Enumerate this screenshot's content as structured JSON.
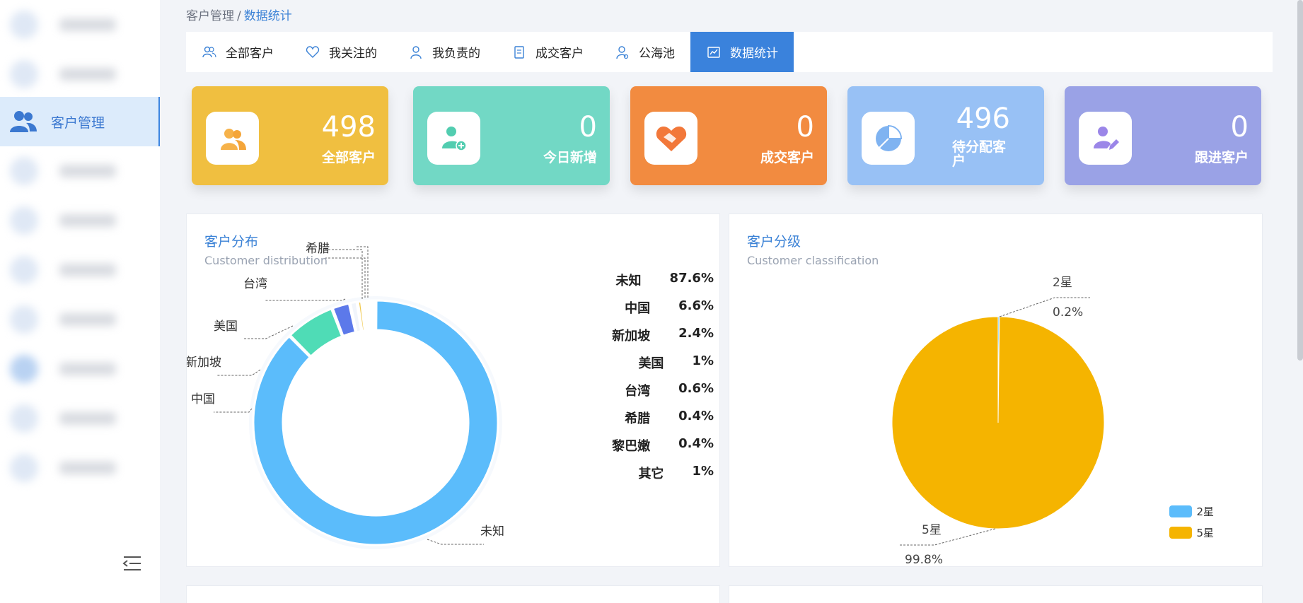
{
  "sidebar": {
    "active_label": "客户管理"
  },
  "breadcrumb": {
    "parent": "客户管理",
    "separator": "/",
    "current": "数据统计"
  },
  "tabs": [
    {
      "label": "全部客户",
      "icon": "users-icon"
    },
    {
      "label": "我关注的",
      "icon": "heart-icon"
    },
    {
      "label": "我负责的",
      "icon": "user-icon"
    },
    {
      "label": "成交客户",
      "icon": "document-icon"
    },
    {
      "label": "公海池",
      "icon": "user-settings-icon"
    },
    {
      "label": "数据统计",
      "icon": "chart-icon"
    }
  ],
  "cards": [
    {
      "value": "498",
      "label": "全部客户",
      "color": "#f0bf40"
    },
    {
      "value": "0",
      "label": "今日新增",
      "color": "#72d8c5"
    },
    {
      "value": "0",
      "label": "成交客户",
      "color": "#f28b40"
    },
    {
      "value": "496",
      "label": "待分配客户",
      "color": "#98c1f5"
    },
    {
      "value": "0",
      "label": "跟进客户",
      "color": "#9aa2e6"
    }
  ],
  "distribution": {
    "title": "客户分布",
    "subtitle": "Customer distribution",
    "chart_data": {
      "type": "pie",
      "categories": [
        "未知",
        "中国",
        "新加坡",
        "美国",
        "台湾",
        "希腊",
        "黎巴嫩",
        "其它"
      ],
      "values": [
        87.6,
        6.6,
        2.4,
        1,
        0.6,
        0.4,
        0.4,
        1
      ],
      "value_labels": [
        "87.6%",
        "6.6%",
        "2.4%",
        "1%",
        "0.6%",
        "0.4%",
        "0.4%",
        "1%"
      ],
      "colors": [
        "#5bbcfb",
        "#4fdcb6",
        "#5c79ea",
        "#f1f5fb",
        "#f0c84a",
        "#f4b8a0",
        "#c0c6d6",
        "#ffffff"
      ]
    }
  },
  "classification": {
    "title": "客户分级",
    "subtitle": "Customer classification",
    "chart_data": {
      "type": "pie",
      "categories": [
        "2星",
        "5星"
      ],
      "values": [
        0.2,
        99.8
      ],
      "value_labels": [
        "0.2%",
        "99.8%"
      ],
      "colors": [
        "#5bbcfb",
        "#f5b400"
      ]
    }
  }
}
